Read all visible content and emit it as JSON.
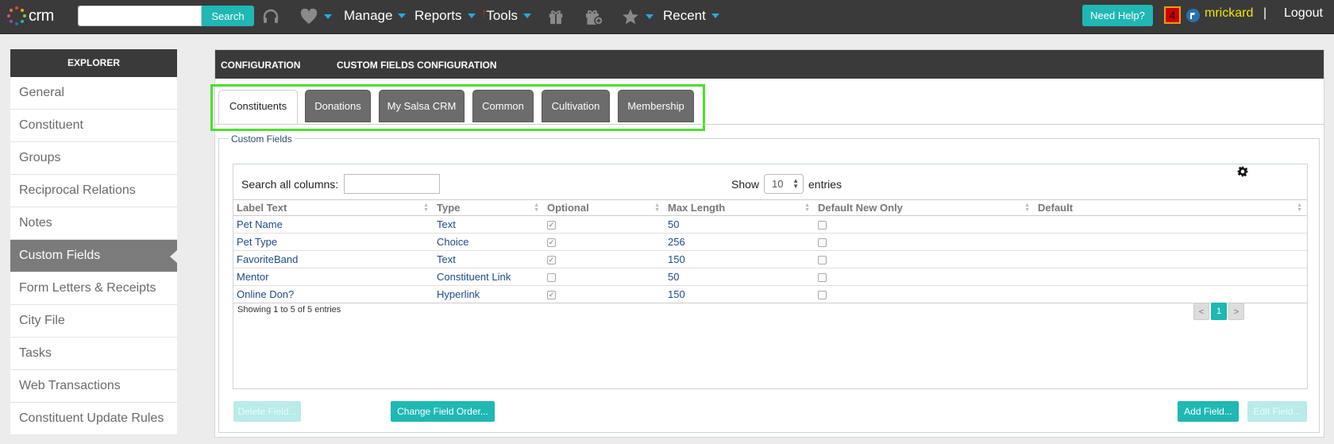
{
  "colors": {
    "accent": "#1fb8b3",
    "topbar": "#3a3a3a",
    "highlight": "#4fdd2f",
    "username": "#f2e600",
    "link": "#1d4a85"
  },
  "topbar": {
    "logo_text": "crm",
    "search_placeholder": "",
    "search_label": "Search",
    "icons": [
      "headset-icon",
      "heart-icon",
      "gift-icon",
      "gift-add-icon",
      "star-icon"
    ],
    "nav": {
      "manage": "Manage",
      "reports": "Reports",
      "tools_bang": "!",
      "tools": "Tools",
      "recent": "Recent"
    },
    "help": "Need Help?",
    "notifications": "4",
    "username": "mrickard",
    "separator": "|",
    "logout": "Logout"
  },
  "sidebar": {
    "title": "EXPLORER",
    "items": [
      "General",
      "Constituent",
      "Groups",
      "Reciprocal Relations",
      "Notes",
      "Custom Fields",
      "Form Letters & Receipts",
      "City File",
      "Tasks",
      "Web Transactions",
      "Constituent Update Rules"
    ],
    "active_index": 5
  },
  "main": {
    "breadcrumb": [
      "CONFIGURATION",
      "CUSTOM FIELDS CONFIGURATION"
    ],
    "tabs": [
      "Constituents",
      "Donations",
      "My Salsa CRM",
      "Common",
      "Cultivation",
      "Membership"
    ],
    "active_tab": 0,
    "fieldset_legend": "Custom Fields",
    "table": {
      "search_label": "Search all columns:",
      "search_value": "",
      "show_label": "Show",
      "page_size": "10",
      "entries_label": "entries",
      "columns": [
        "Label Text",
        "Type",
        "Optional",
        "Max Length",
        "Default New Only",
        "Default"
      ],
      "rows": [
        {
          "label": "Pet Name",
          "type": "Text",
          "optional": true,
          "max_length": "50",
          "default_new_only": false,
          "default": ""
        },
        {
          "label": "Pet Type",
          "type": "Choice",
          "optional": true,
          "max_length": "256",
          "default_new_only": false,
          "default": ""
        },
        {
          "label": "FavoriteBand",
          "type": "Text",
          "optional": true,
          "max_length": "150",
          "default_new_only": false,
          "default": ""
        },
        {
          "label": "Mentor",
          "type": "Constituent Link",
          "optional": false,
          "max_length": "50",
          "default_new_only": false,
          "default": ""
        },
        {
          "label": "Online Don?",
          "type": "Hyperlink",
          "optional": true,
          "max_length": "150",
          "default_new_only": false,
          "default": ""
        }
      ],
      "info": "Showing 1 to 5 of 5 entries",
      "pager": {
        "prev": "<",
        "current": "1",
        "next": ">"
      }
    },
    "buttons": {
      "delete": "Delete Field...",
      "change_order": "Change Field Order...",
      "add": "Add Field...",
      "edit": "Edit Field..."
    }
  }
}
